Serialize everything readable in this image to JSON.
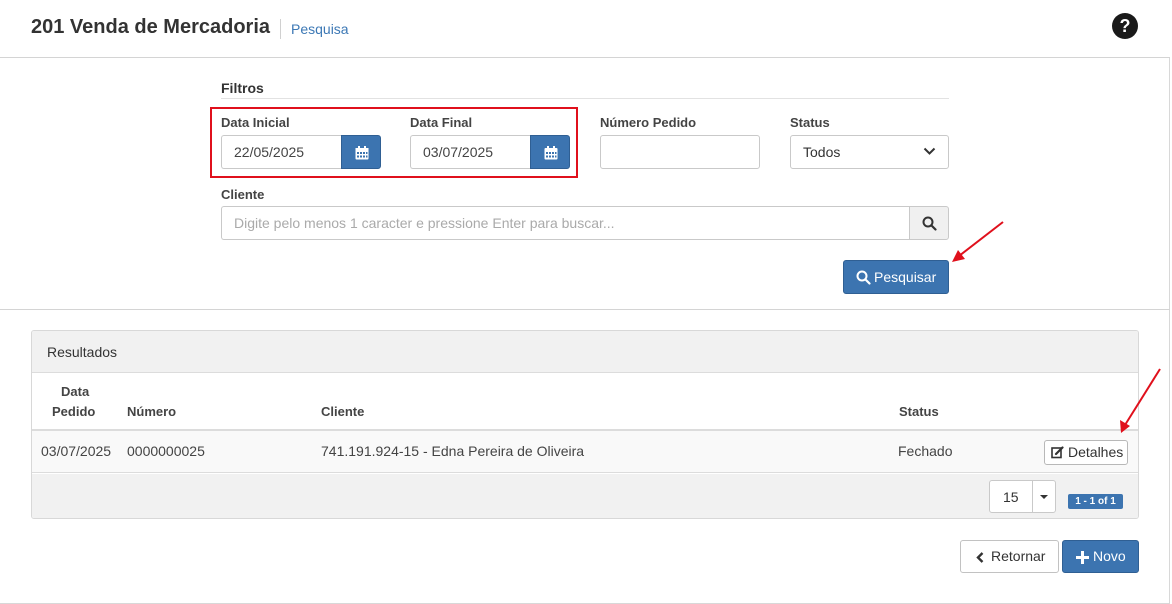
{
  "header": {
    "title": "201 Venda de Mercadoria",
    "subtitle": "Pesquisa",
    "help_icon": "question-circle-icon"
  },
  "filters": {
    "section_title": "Filtros",
    "data_inicial": {
      "label": "Data Inicial",
      "value": "22/05/2025"
    },
    "data_final": {
      "label": "Data Final",
      "value": "03/07/2025"
    },
    "numero_pedido": {
      "label": "Número Pedido",
      "value": ""
    },
    "status": {
      "label": "Status",
      "selected": "Todos"
    },
    "cliente": {
      "label": "Cliente",
      "placeholder": "Digite pelo menos 1 caracter e pressione Enter para buscar..."
    },
    "search_button": "Pesquisar"
  },
  "results": {
    "title": "Resultados",
    "columns": [
      "Data",
      "Pedido",
      "Número",
      "Cliente",
      "Status"
    ],
    "rows": [
      {
        "data_pedido": "03/07/2025",
        "numero": "0000000025",
        "cliente": "741.191.924-15 - Edna Pereira de Oliveira",
        "status": "Fechado",
        "action": "Detalhes"
      }
    ],
    "page_size": "15",
    "page_info": "1 - 1 of 1"
  },
  "actions": {
    "back": "Retornar",
    "new": "Novo"
  },
  "colors": {
    "primary": "#3c74b0",
    "link": "#3c78b5",
    "highlight_box": "#e0101c",
    "annotation_arrow": "#e0101c"
  }
}
